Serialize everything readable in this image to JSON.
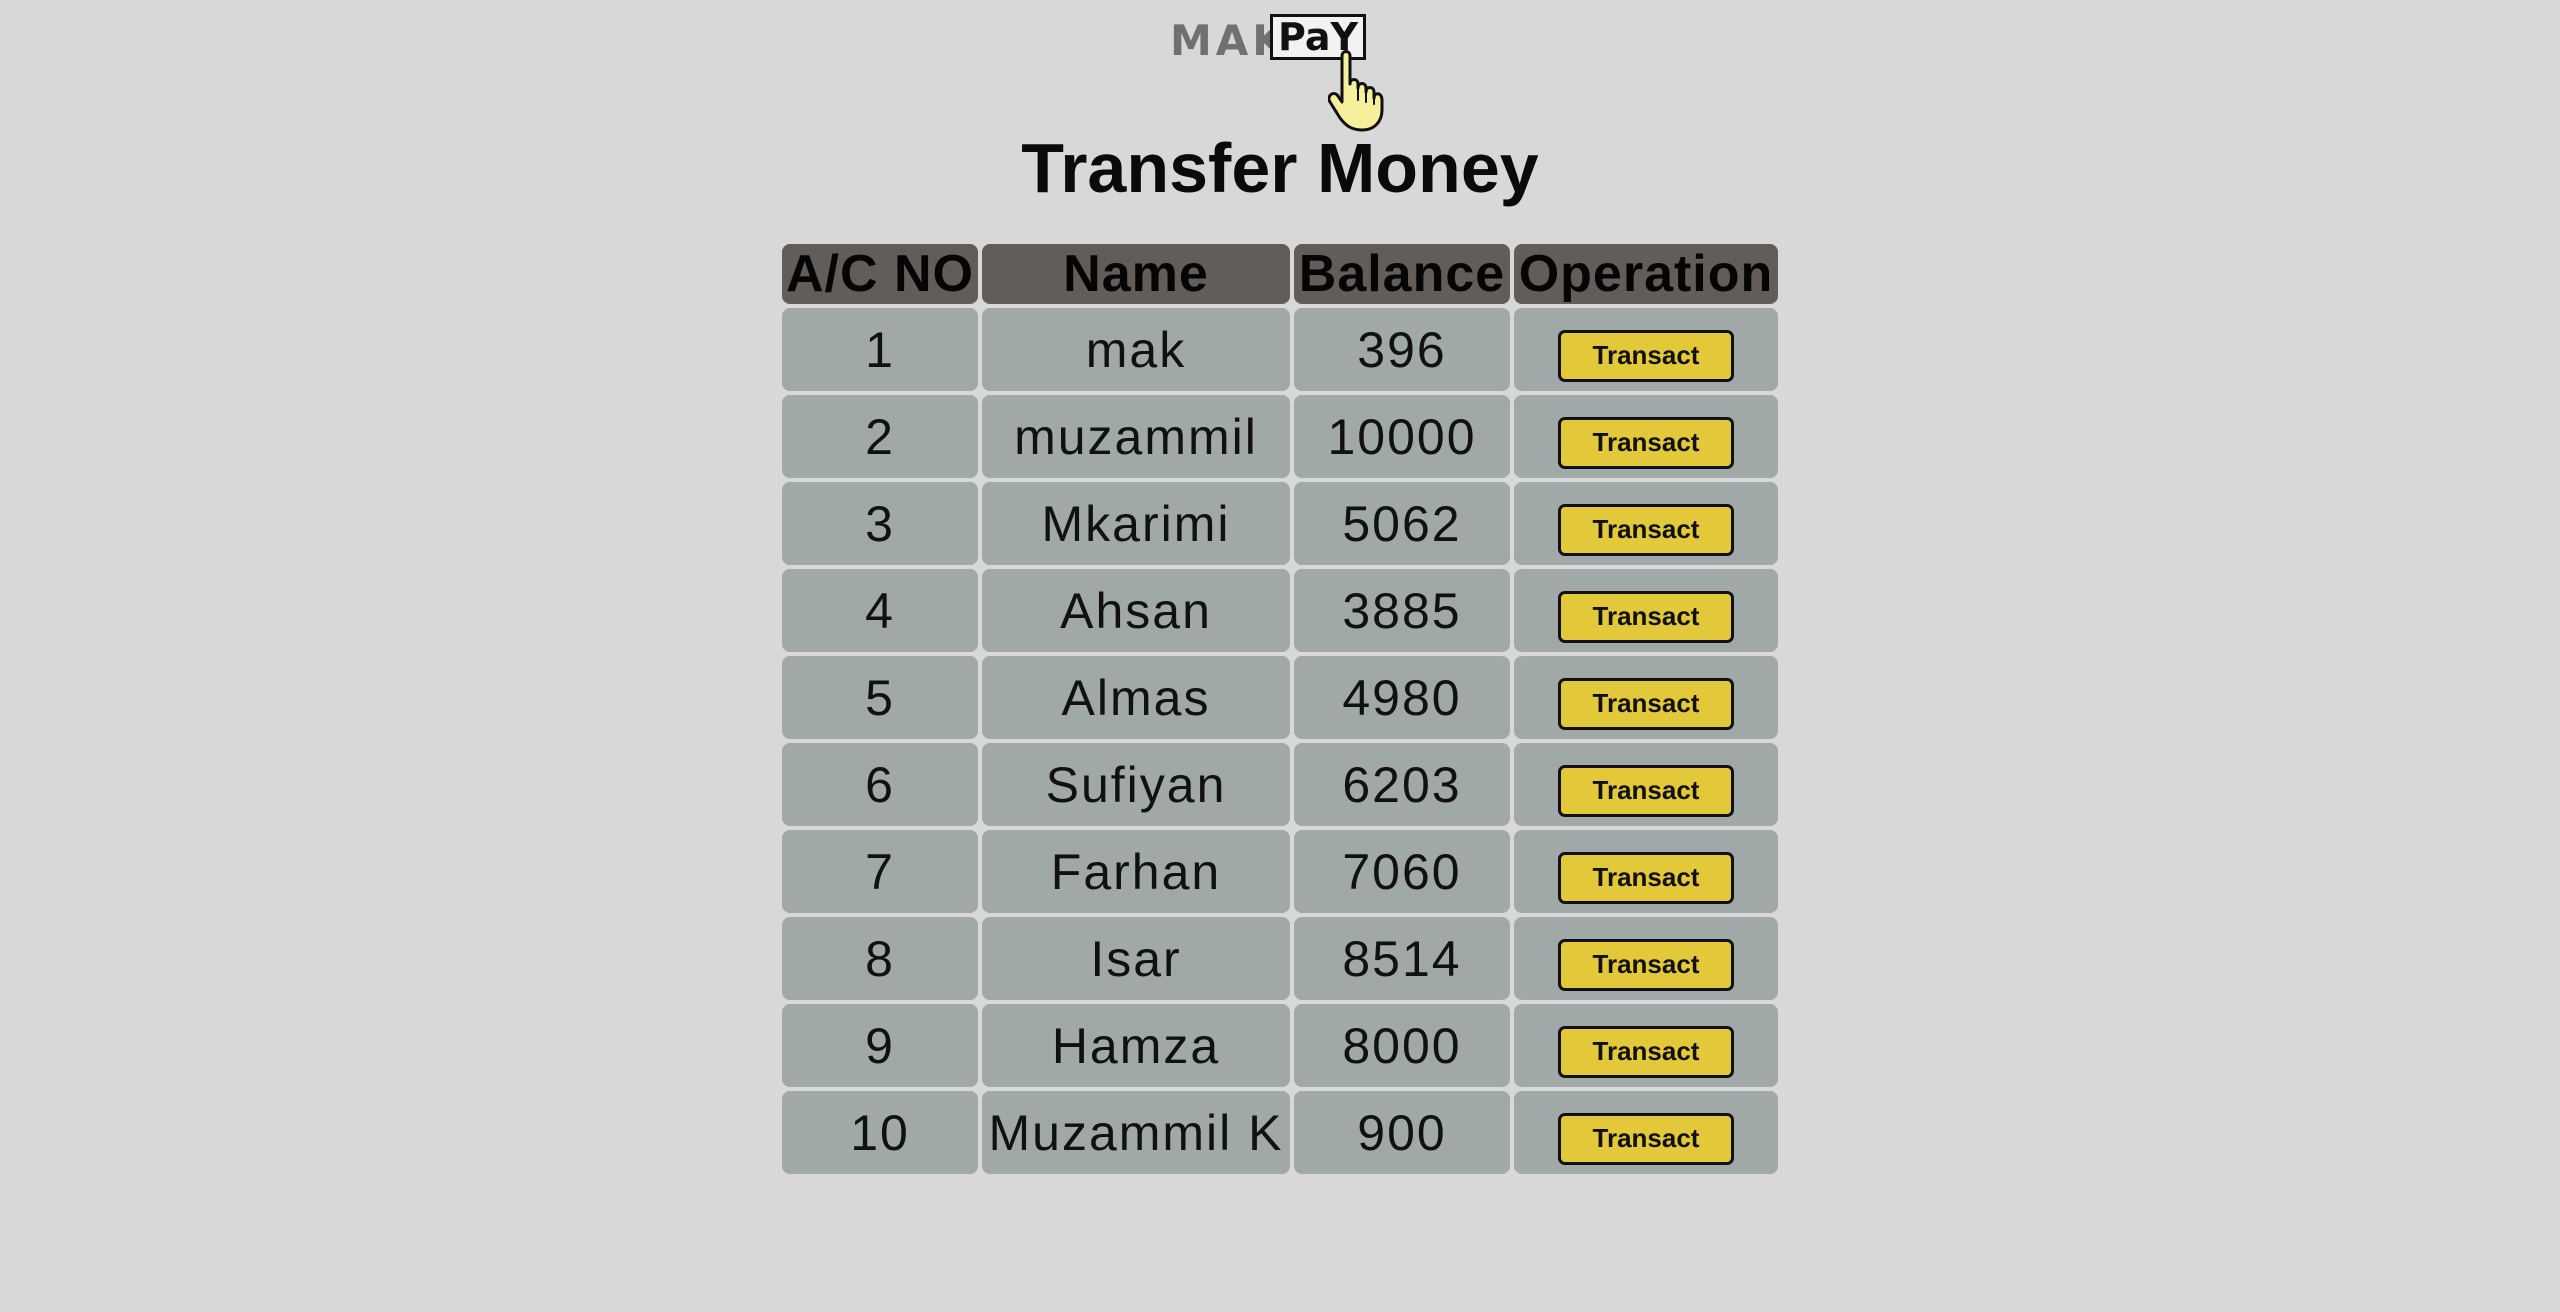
{
  "logo": {
    "part1": "MAK",
    "part2": "PaY",
    "icon": "pointing-hand-icon"
  },
  "page_title": "Transfer Money",
  "table": {
    "headers": {
      "acno": "A/C NO",
      "name": "Name",
      "balance": "Balance",
      "operation": "Operation"
    },
    "rows": [
      {
        "acno": "1",
        "name": "mak",
        "balance": "396",
        "action": "Transact"
      },
      {
        "acno": "2",
        "name": "muzammil",
        "balance": "10000",
        "action": "Transact"
      },
      {
        "acno": "3",
        "name": "Mkarimi",
        "balance": "5062",
        "action": "Transact"
      },
      {
        "acno": "4",
        "name": "Ahsan",
        "balance": "3885",
        "action": "Transact"
      },
      {
        "acno": "5",
        "name": "Almas",
        "balance": "4980",
        "action": "Transact"
      },
      {
        "acno": "6",
        "name": "Sufiyan",
        "balance": "6203",
        "action": "Transact"
      },
      {
        "acno": "7",
        "name": "Farhan",
        "balance": "7060",
        "action": "Transact"
      },
      {
        "acno": "8",
        "name": "Isar",
        "balance": "8514",
        "action": "Transact"
      },
      {
        "acno": "9",
        "name": "Hamza",
        "balance": "8000",
        "action": "Transact"
      },
      {
        "acno": "10",
        "name": "Muzammil K",
        "balance": "900",
        "action": "Transact"
      }
    ]
  },
  "colors": {
    "background": "#d8d8d8",
    "header_cell": "#625d58",
    "body_cell": "#a1a8a8",
    "button": "#e3c83a"
  }
}
